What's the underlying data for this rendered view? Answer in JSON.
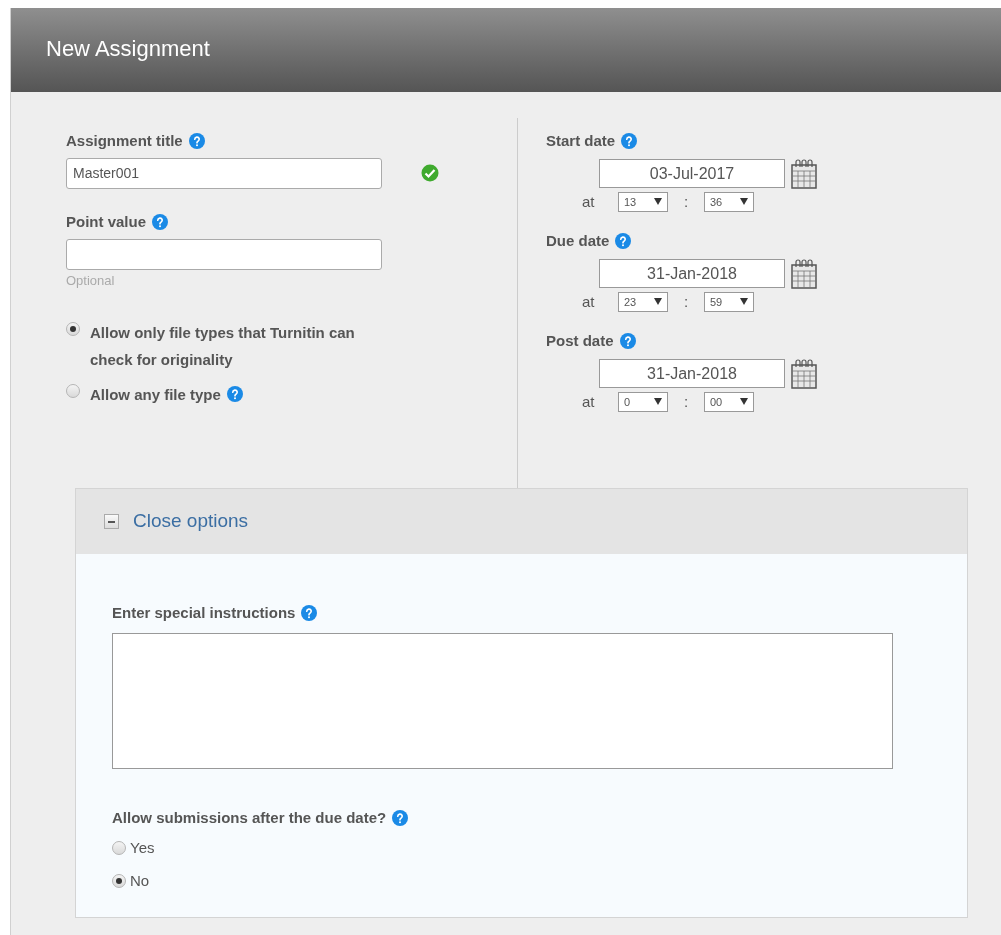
{
  "title": "New Assignment",
  "assignment_title": {
    "label": "Assignment title",
    "value": "Master001",
    "valid": true
  },
  "point_value": {
    "label": "Point value",
    "hint": "Optional"
  },
  "file_type_options": [
    {
      "label": "Allow only file types that Turnitin can check for originality",
      "selected": true,
      "help": false
    },
    {
      "label": "Allow any file type",
      "selected": false,
      "help": true
    }
  ],
  "dates": [
    {
      "label": "Start date",
      "date": "03-Jul-2017",
      "at": "at",
      "hour": "13",
      "separator": ":",
      "minute": "36"
    },
    {
      "label": "Due date",
      "date": "31-Jan-2018",
      "at": "at",
      "hour": "23",
      "separator": ":",
      "minute": "59"
    },
    {
      "label": "Post date",
      "date": "31-Jan-2018",
      "at": "at",
      "hour": "0",
      "separator": ":",
      "minute": "00"
    }
  ],
  "close_options": {
    "label": "Close options",
    "expanded": true
  },
  "special_instructions": {
    "label": "Enter special instructions"
  },
  "late_submissions": {
    "label": "Allow submissions after the due date?",
    "options": [
      {
        "label": "Yes",
        "selected": false
      },
      {
        "label": "No",
        "selected": true
      }
    ]
  }
}
